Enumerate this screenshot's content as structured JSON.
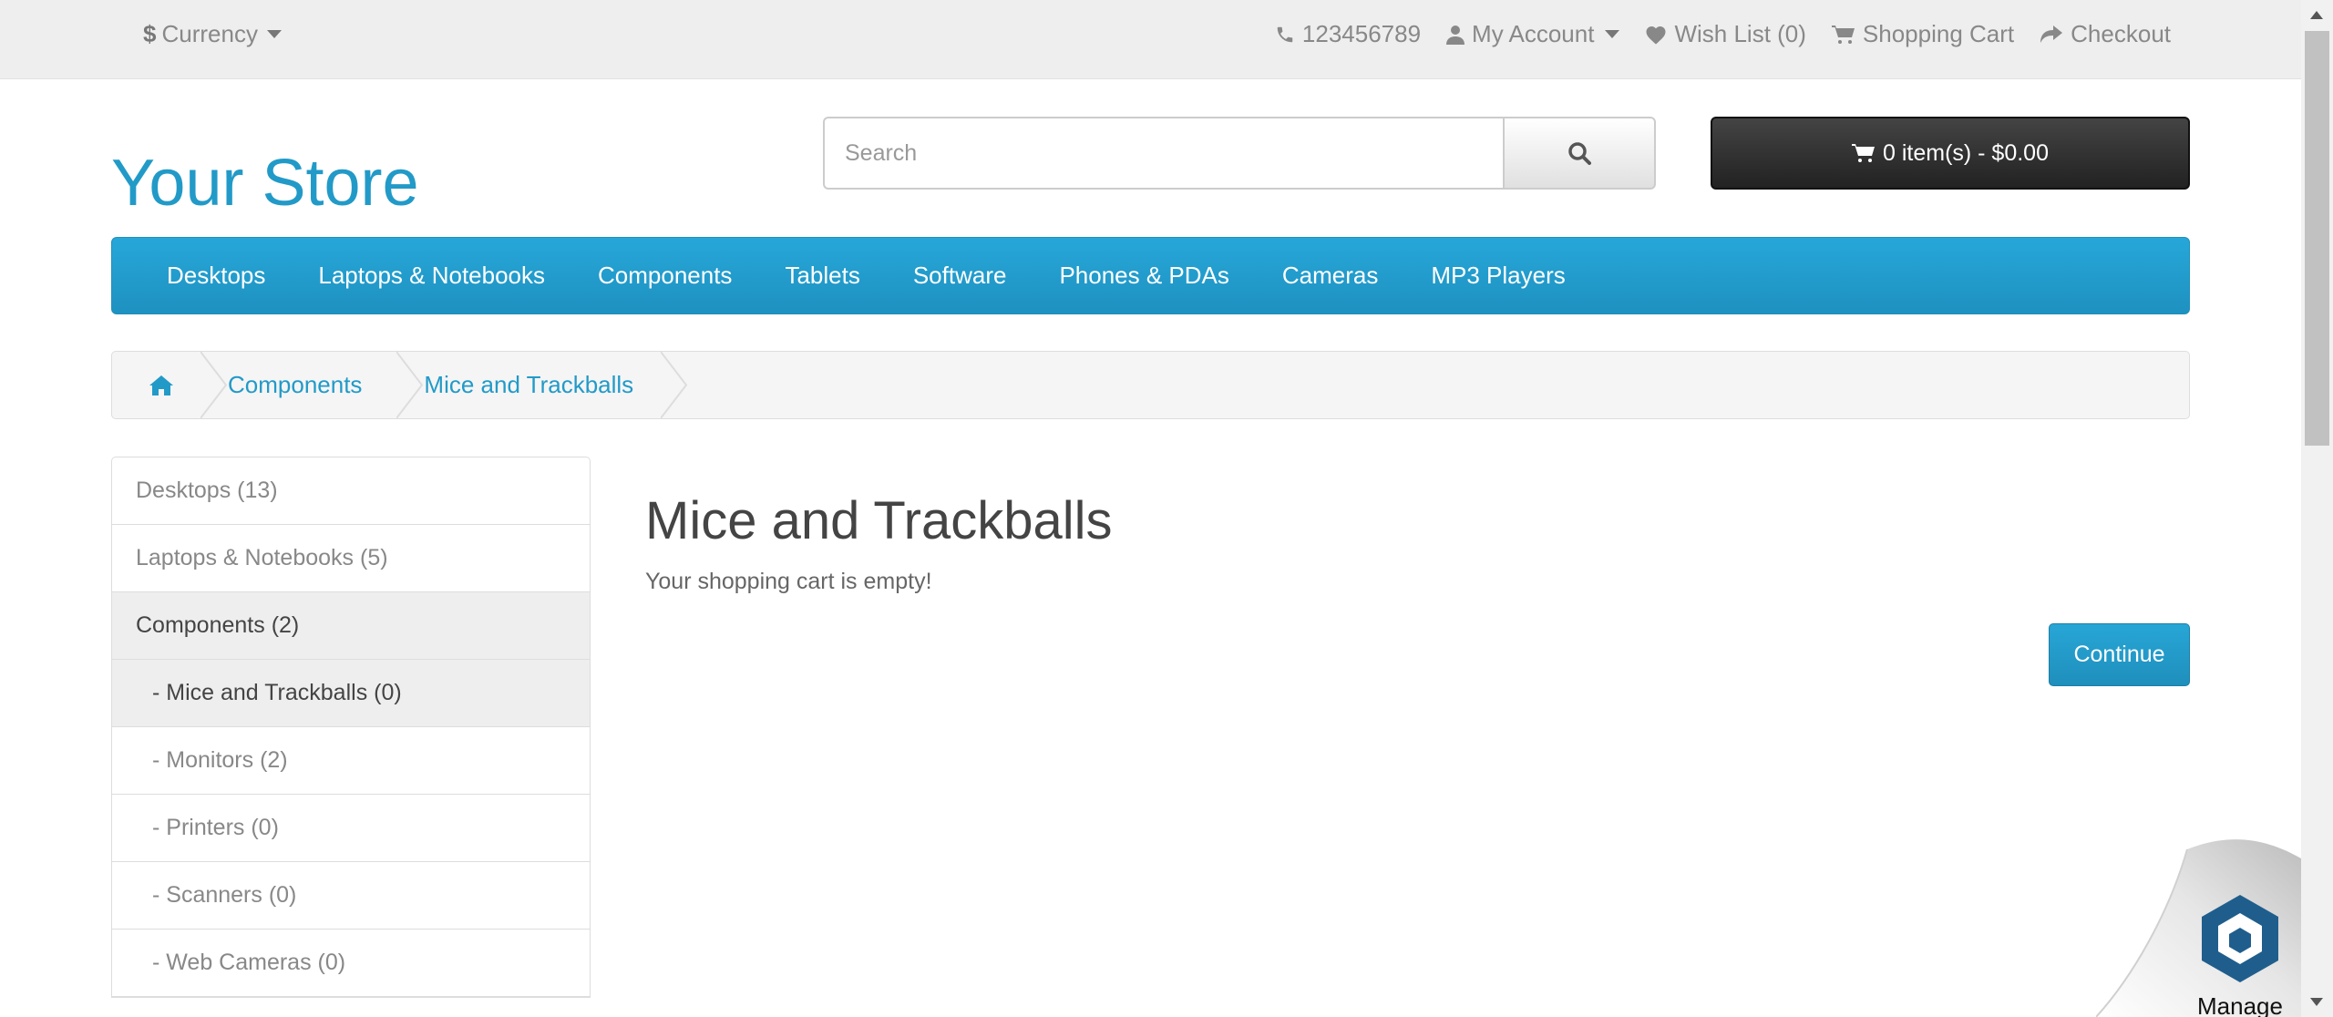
{
  "topbar": {
    "currency_label": "Currency",
    "currency_symbol": "$",
    "phone": "123456789",
    "my_account": "My Account",
    "wish_list": "Wish List (0)",
    "shopping_cart": "Shopping Cart",
    "checkout": "Checkout"
  },
  "header": {
    "logo": "Your Store",
    "search_placeholder": "Search",
    "cart_label": "0 item(s) - $0.00"
  },
  "menu": {
    "items": [
      "Desktops",
      "Laptops & Notebooks",
      "Components",
      "Tablets",
      "Software",
      "Phones & PDAs",
      "Cameras",
      "MP3 Players"
    ]
  },
  "breadcrumb": {
    "items": [
      "Components",
      "Mice and Trackballs"
    ]
  },
  "sidebar": {
    "items": [
      "Desktops (13)",
      "Laptops & Notebooks (5)",
      "Components (2)",
      "- Mice and Trackballs (0)",
      "- Monitors (2)",
      "- Printers (0)",
      "- Scanners (0)",
      "- Web Cameras (0)"
    ]
  },
  "content": {
    "title": "Mice and Trackballs",
    "message": "Your shopping cart is empty!",
    "continue_label": "Continue"
  },
  "badge": {
    "label": "Manage"
  },
  "colors": {
    "accent": "#229ac8",
    "cart_button": "#2b2b2b",
    "topbar": "#eeeeee"
  }
}
